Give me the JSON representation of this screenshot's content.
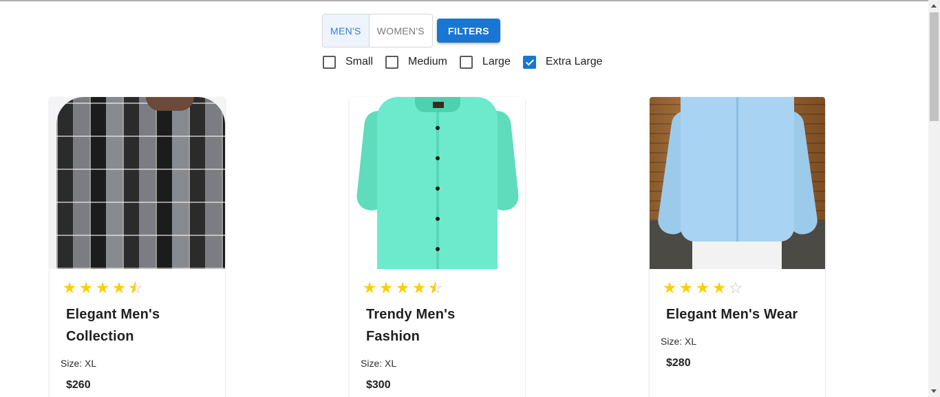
{
  "gender_tabs": {
    "mens_label": "MEN'S",
    "womens_label": "WOMEN'S",
    "active": "MEN'S"
  },
  "filters_button_label": "FILTERS",
  "size_filters": [
    {
      "label": "Small",
      "checked": false
    },
    {
      "label": "Medium",
      "checked": false
    },
    {
      "label": "Large",
      "checked": false
    },
    {
      "label": "Extra Large",
      "checked": true
    }
  ],
  "products": [
    {
      "title": "Elegant Men's Collection",
      "rating": 4.5,
      "size_text": "Size: XL",
      "price": "$260",
      "image": "black-grey-check-shirt"
    },
    {
      "title": "Trendy Men's Fashion",
      "rating": 4.5,
      "size_text": "Size: XL",
      "price": "$300",
      "image": "mint-green-shirt"
    },
    {
      "title": "Elegant Men's Wear",
      "rating": 4,
      "size_text": "Size: XL",
      "price": "$280",
      "image": "light-blue-denim-shirt"
    }
  ],
  "colors": {
    "accent": "#1976d2",
    "active_tab_text": "#2f7fd1",
    "active_tab_bg": "#eef4fc",
    "star": "#fcd000",
    "star_empty": "#c2c2c2"
  },
  "icons": {
    "star_full": "star-icon",
    "star_half": "star-half-icon",
    "star_empty": "star-outline-icon",
    "checkbox": "checkbox-icon"
  }
}
